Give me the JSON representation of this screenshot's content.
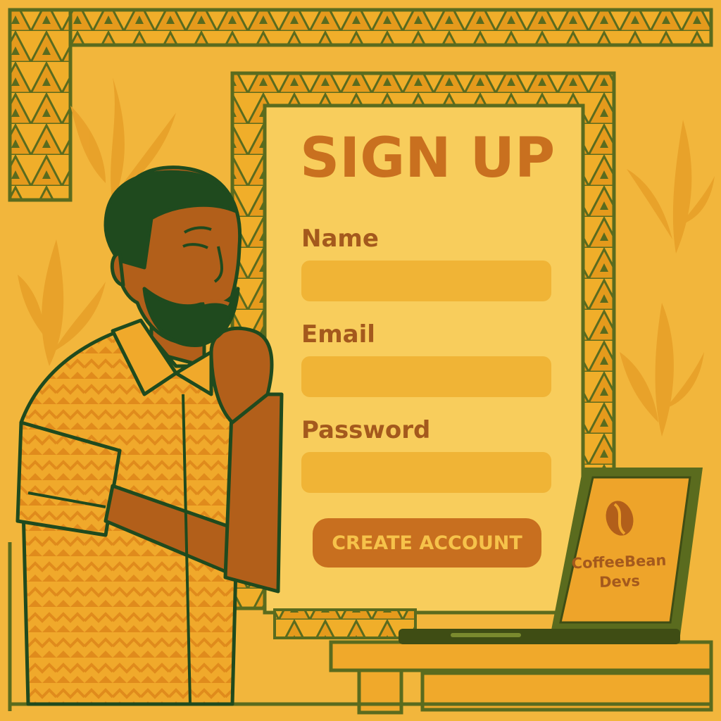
{
  "form": {
    "title": "SIGN UP",
    "fields": [
      {
        "label": "Name",
        "value": "",
        "placeholder": ""
      },
      {
        "label": "Email",
        "value": "",
        "placeholder": ""
      },
      {
        "label": "Password",
        "value": "",
        "placeholder": ""
      }
    ],
    "submit_label": "CREATE ACCOUNT"
  },
  "laptop": {
    "brand_line1": "CoffeeBean",
    "brand_line2": "Devs",
    "logo_icon": "coffee-bean-icon"
  },
  "colors": {
    "background": "#f2b63c",
    "panel": "#f8cd5c",
    "border_green": "#5a6b1e",
    "accent_orange": "#c86f1f",
    "text_brown": "#a4591d"
  }
}
